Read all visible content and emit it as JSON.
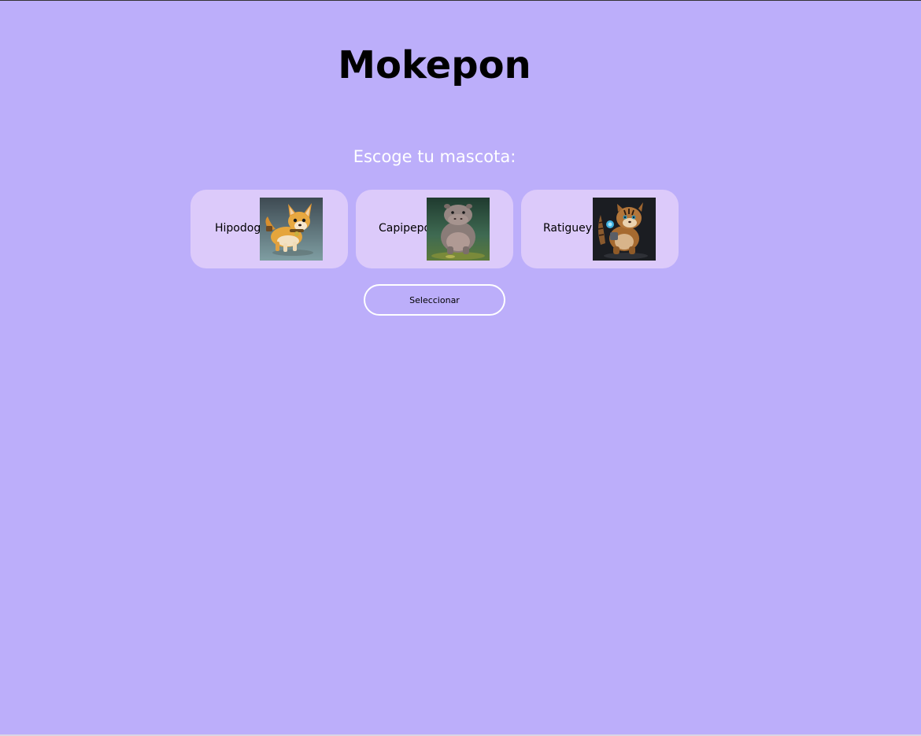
{
  "header": {
    "title": "Mokepon"
  },
  "selection": {
    "prompt": "Escoge tu mascota:",
    "pets": [
      {
        "label": "Hipodoge",
        "image": "corgi-dog-figure"
      },
      {
        "label": "Capipepo",
        "image": "hippo-figure"
      },
      {
        "label": "Ratigueya",
        "image": "tiger-cub-figure"
      }
    ],
    "select_label": "Seleccionar"
  },
  "colors": {
    "background": "#bcaefa",
    "card": "#dccafa",
    "subtitle": "#ffffff",
    "button_border": "#ffffff"
  }
}
